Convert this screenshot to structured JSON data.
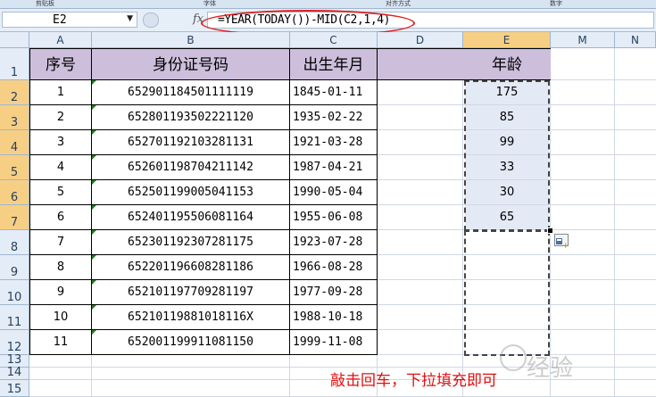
{
  "ribbon": {
    "tabs": [
      "剪贴板",
      "字体",
      "对齐方式",
      "数字"
    ]
  },
  "formula_bar": {
    "name_box": "E2",
    "fx_label": "fx",
    "formula": "=YEAR(TODAY())-MID(C2,1,4)"
  },
  "columns": [
    "A",
    "B",
    "C",
    "D",
    "E",
    "M",
    "N"
  ],
  "rows": [
    "1",
    "2",
    "3",
    "4",
    "5",
    "6",
    "7",
    "8",
    "9",
    "10",
    "11",
    "12",
    "13",
    "14",
    "15"
  ],
  "headers": {
    "seq": "序号",
    "id": "身份证号码",
    "birth": "出生年月",
    "age": "年龄"
  },
  "table": [
    {
      "seq": "1",
      "id": "652901184501111119",
      "birth": "1845-01-11",
      "age": "175"
    },
    {
      "seq": "2",
      "id": "652801193502221120",
      "birth": "1935-02-22",
      "age": "85"
    },
    {
      "seq": "3",
      "id": "652701192103281131",
      "birth": "1921-03-28",
      "age": "99"
    },
    {
      "seq": "4",
      "id": "652601198704211142",
      "birth": "1987-04-21",
      "age": "33"
    },
    {
      "seq": "5",
      "id": "652501199005041153",
      "birth": "1990-05-04",
      "age": "30"
    },
    {
      "seq": "6",
      "id": "652401195506081164",
      "birth": "1955-06-08",
      "age": "65"
    },
    {
      "seq": "7",
      "id": "652301192307281175",
      "birth": "1923-07-28",
      "age": ""
    },
    {
      "seq": "8",
      "id": "652201196608281186",
      "birth": "1966-08-28",
      "age": ""
    },
    {
      "seq": "9",
      "id": "652101197709281197",
      "birth": "1977-09-28",
      "age": ""
    },
    {
      "seq": "10",
      "id": "65210119881018116X",
      "birth": "1988-10-18",
      "age": ""
    },
    {
      "seq": "11",
      "id": "652001199911081150",
      "birth": "1999-11-08",
      "age": ""
    }
  ],
  "hint": "敲击回车，下拉填充即可",
  "watermark": "经验",
  "colors": {
    "header_fill": "#cdbfdc",
    "active_header": "#f7cf84",
    "hint_red": "#e01010"
  }
}
